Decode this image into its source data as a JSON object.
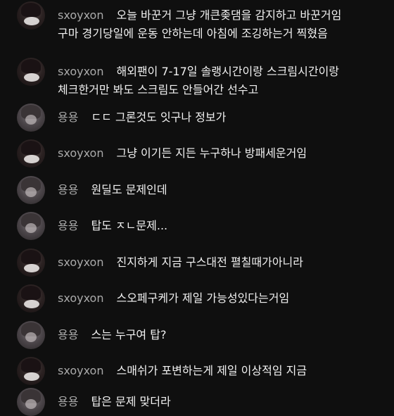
{
  "messages": [
    {
      "author": "sxoyxon",
      "avatar": "dark",
      "lines": [
        "오늘 바꾼거 그냥 개큰좆댐을 감지하고 바꾼거임",
        "구마 경기당일에 운동 안하는데 아침에 조깅하는거 찍혔음"
      ]
    },
    {
      "author": "sxoyxon",
      "avatar": "dark",
      "lines": [
        "해외팬이 7-17일 솔랭시간이랑 스크림시간이랑",
        "체크한거만 봐도 스크림도 안들어간 선수고"
      ]
    },
    {
      "author": "용용",
      "avatar": "grey",
      "lines": [
        "ㄷㄷ 그론것도 잇구나 정보가"
      ]
    },
    {
      "author": "sxoyxon",
      "avatar": "dark",
      "lines": [
        "그냥 이기든 지든 누구하나 방패세운거임"
      ]
    },
    {
      "author": "용용",
      "avatar": "grey",
      "lines": [
        "원딜도 문제인데"
      ]
    },
    {
      "author": "용용",
      "avatar": "grey",
      "lines": [
        "탑도 ㅈㄴ문제..."
      ]
    },
    {
      "author": "sxoyxon",
      "avatar": "dark",
      "lines": [
        "진지하게 지금 구스대전 펼칠때가아니라"
      ]
    },
    {
      "author": "sxoyxon",
      "avatar": "dark",
      "lines": [
        "스오페구케가 제일 가능성있다는거임"
      ]
    },
    {
      "author": "용용",
      "avatar": "grey",
      "lines": [
        "스는 누구여 탑?"
      ]
    },
    {
      "author": "sxoyxon",
      "avatar": "dark",
      "lines": [
        "스매쉬가 포변하는게 제일 이상적임 지금"
      ]
    },
    {
      "author": "용용",
      "avatar": "grey",
      "lines": [
        "탑은 문제 맞더라"
      ]
    }
  ]
}
